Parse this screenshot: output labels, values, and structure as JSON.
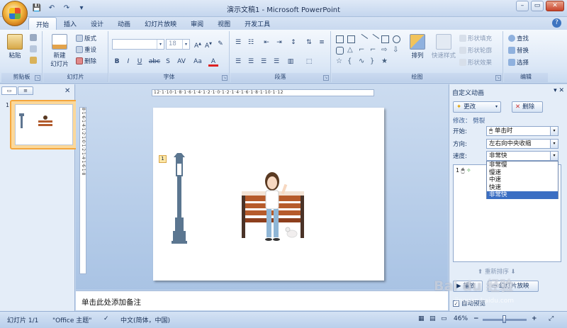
{
  "window": {
    "title": "演示文稿1 - Microsoft PowerPoint",
    "controls": {
      "minimize": "–",
      "restore": "▭",
      "close": "✕"
    }
  },
  "quick_access": {
    "save": "💾",
    "undo": "↶",
    "redo": "↷",
    "more": "▾"
  },
  "tabs": [
    {
      "label": "开始",
      "active": true
    },
    {
      "label": "插入"
    },
    {
      "label": "设计"
    },
    {
      "label": "动画"
    },
    {
      "label": "幻灯片放映"
    },
    {
      "label": "审阅"
    },
    {
      "label": "视图"
    },
    {
      "label": "开发工具"
    }
  ],
  "help": "?",
  "ribbon": {
    "clipboard": {
      "label": "剪贴板",
      "paste": "粘贴"
    },
    "slides": {
      "label": "幻灯片",
      "new_slide": "新建",
      "new_slide2": "幻灯片",
      "layout": "版式",
      "reset": "重设",
      "delete": "删除"
    },
    "font": {
      "label": "字体",
      "size": "18",
      "buttons": [
        "B",
        "I",
        "U",
        "abc",
        "S",
        "AV",
        "Aa",
        "A"
      ]
    },
    "paragraph": {
      "label": "段落"
    },
    "drawing": {
      "label": "绘图",
      "arrange": "排列",
      "quick_styles": "快速样式",
      "fill": "形状填充",
      "outline": "形状轮廓",
      "effect": "形状效果"
    },
    "editing": {
      "label": "编辑",
      "find": "查找",
      "replace": "替换",
      "select": "选择"
    }
  },
  "left_pane": {
    "slide_number": "1"
  },
  "rulers": {
    "horizontal": "12·1·10·1·8·1·6·1·4·1·2·1·0·1·2·1·4·1·6·1·8·1·10·1·12",
    "vertical": "8·1·6·1·4·1·2·1·0·1·2·1·4·1·6·1·8"
  },
  "slide": {
    "animation_tag": "1"
  },
  "notes": {
    "placeholder": "单击此处添加备注"
  },
  "animation_pane": {
    "title": "自定义动画",
    "change": "更改",
    "delete": "删除",
    "modify": "修改： 劈裂",
    "start_label": "开始:",
    "start_value": "单击时",
    "direction_label": "方向:",
    "direction_value": "左右向中央收缩",
    "speed_label": "速度:",
    "speed_value": "非常快",
    "speed_options": [
      "非常慢",
      "慢速",
      "中速",
      "快速",
      "非常快"
    ],
    "list_item": "1",
    "reorder": "重新排序",
    "play": "播放",
    "slideshow": "幻灯片放映",
    "autopreview": "自动预览"
  },
  "status": {
    "slide": "幻灯片 1/1",
    "theme": "\"Office 主题\"",
    "language": "中文(简体，中国)",
    "zoom": "46%",
    "zoom_out": "−",
    "zoom_in": "+"
  },
  "watermark": {
    "main": "Bai du 经验",
    "sub": "jingyan.baidu.com"
  },
  "colors": {
    "accent": "#f5a63c",
    "selection": "#3a6ec3",
    "chrome": "#c5d7ee"
  }
}
